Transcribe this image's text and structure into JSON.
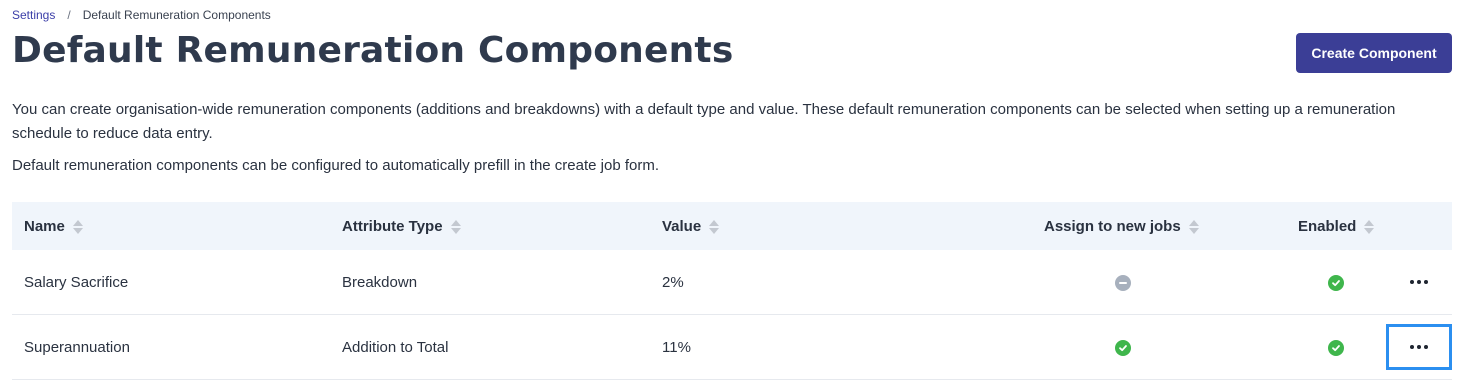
{
  "breadcrumb": {
    "parent": "Settings",
    "separator": "/",
    "current": "Default Remuneration Components"
  },
  "page": {
    "title": "Default Remuneration Components",
    "create_button": "Create Component",
    "description_1": "You can create organisation-wide remuneration components (additions and breakdowns) with a default type and value. These default remuneration components can be selected when setting up a remuneration schedule to reduce data entry.",
    "description_2": "Default remuneration components can be configured to automatically prefill in the create job form."
  },
  "table": {
    "columns": {
      "name": "Name",
      "attribute_type": "Attribute Type",
      "value": "Value",
      "assign": "Assign to new jobs",
      "enabled": "Enabled"
    },
    "rows": [
      {
        "name": "Salary Sacrifice",
        "attribute_type": "Breakdown",
        "value": "2%",
        "assign_to_new_jobs": false,
        "enabled": true
      },
      {
        "name": "Superannuation",
        "attribute_type": "Addition to Total",
        "value": "11%",
        "assign_to_new_jobs": true,
        "enabled": true
      }
    ]
  },
  "colors": {
    "primary": "#3b3e96",
    "success": "#3fb64c",
    "muted": "#a7b0bd",
    "focus": "#2b8ff0",
    "header_bg": "#f0f5fb"
  },
  "icons": {
    "sort": "sort-icon",
    "check": "check-circle-icon",
    "minus": "minus-circle-icon",
    "more": "more-horizontal-icon"
  }
}
